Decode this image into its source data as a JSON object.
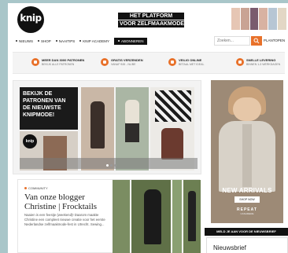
{
  "header": {
    "logo_text": "knip",
    "tagline_line1": "HET PLATFORM",
    "tagline_line2": "VOOR ZELFMAAKMODE"
  },
  "nav": {
    "items": [
      "NIEUWS",
      "SHOP",
      "NAAITIPS",
      "KNIP ACADEMY"
    ],
    "subscribe_label": "ABONNEREN",
    "search_placeholder": "Zoeken...",
    "right_label": "PLANTOPEN"
  },
  "usp": [
    {
      "title": "MEER DAN 3000 PATRONEN",
      "sub": "BEKIJK ALLE PATRONEN"
    },
    {
      "title": "GRATIS VERZENDEN",
      "sub": "VANAF €45 - NL/BE"
    },
    {
      "title": "VEILIG ONLINE",
      "sub": "BETAAL MET IDEAL"
    },
    {
      "title": "SNELLE LEVERING",
      "sub": "BINNEN 1-3 WERKDAGEN"
    }
  ],
  "hero": {
    "headline": "BEKIJK DE PATRONEN VAN DE NIEUWSTE KNIPMODE!",
    "mag_logo": "knip"
  },
  "blog": {
    "tag": "COMMUNITY",
    "title": "Van onze blogger Christine | Frocktails",
    "body": "Naaien is een feestje (weekend)! Daarom maakte Christine een compleet nieuwe creatie voor het eerste Nederlandse zelfmaakmode-fest in Utrecht. Sewing..."
  },
  "ad": {
    "label": "NEW ARRIVALS",
    "button": "SHOP NOW",
    "brand": "REPEAT",
    "brand_sub": "CASHMERE"
  },
  "newsletter": {
    "bar": "MELD JE AAN VOOR DE NIEUWSBRIEF",
    "title": "Nieuwsbrief"
  },
  "colors": {
    "accent": "#e8712a",
    "dark": "#111111"
  }
}
